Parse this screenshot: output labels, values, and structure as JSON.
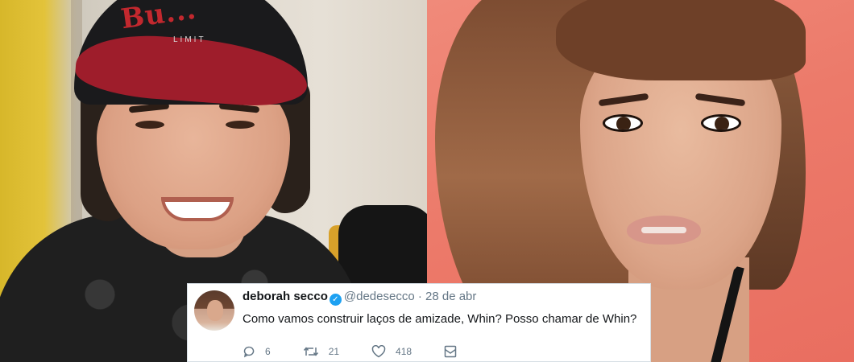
{
  "photos": {
    "left": {
      "cap_text": "Bu...",
      "cap_subtext": "LIMIT"
    },
    "right": {}
  },
  "tweet": {
    "name": "deborah secco",
    "verified": true,
    "handle": "@dedesecco",
    "separator": "·",
    "date": "28 de abr",
    "text": "Como vamos construir laços de amizade, Whin? Posso chamar de Whin?",
    "actions": {
      "reply_count": "6",
      "retweet_count": "21",
      "like_count": "418"
    },
    "icons": [
      "reply-icon",
      "retweet-icon",
      "like-icon",
      "direct-message-icon",
      "verified-icon"
    ]
  },
  "colors": {
    "twitter_blue": "#1da1f2",
    "text_primary": "#14171a",
    "text_secondary": "#657786",
    "right_bg": "#ec7a6a"
  }
}
